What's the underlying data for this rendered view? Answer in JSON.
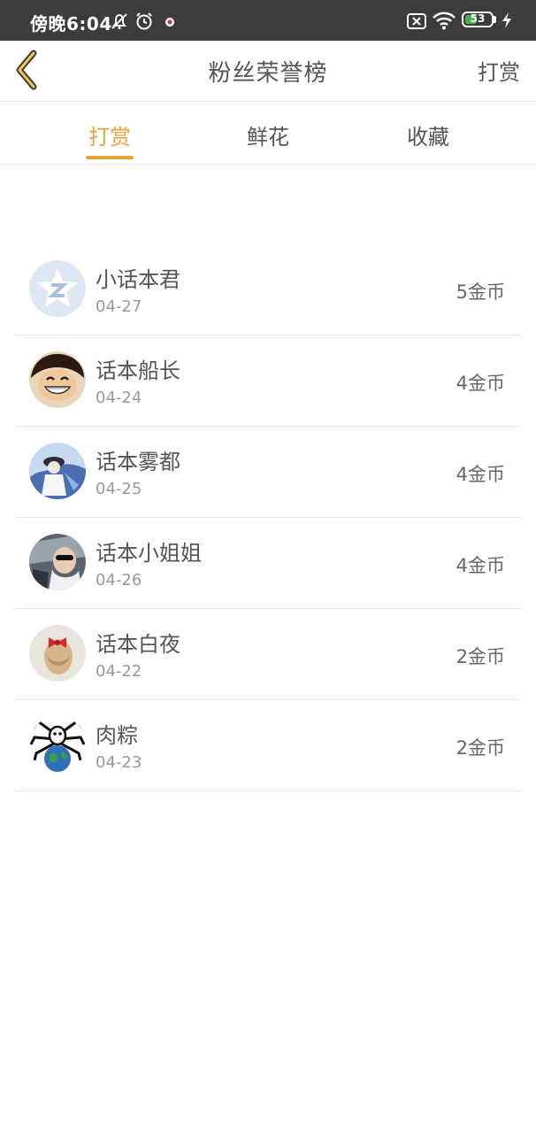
{
  "status": {
    "time": "傍晚6:04",
    "battery_level": "53",
    "battery_fraction": 0.53
  },
  "header": {
    "title": "粉丝荣誉榜",
    "action_label": "打赏"
  },
  "tabs": [
    {
      "label": "打赏",
      "active": true
    },
    {
      "label": "鲜花",
      "active": false
    },
    {
      "label": "收藏",
      "active": false
    }
  ],
  "list": [
    {
      "name": "小话本君",
      "date": "04-27",
      "amount": "5金币",
      "avatar": "qq-default-avatar"
    },
    {
      "name": "话本船长",
      "date": "04-24",
      "amount": "4金币",
      "avatar": "cartoon-face-avatar"
    },
    {
      "name": "话本雾都",
      "date": "04-25",
      "amount": "4金币",
      "avatar": "blue-figure-avatar"
    },
    {
      "name": "话本小姐姐",
      "date": "04-26",
      "amount": "4金币",
      "avatar": "car-selfie-avatar"
    },
    {
      "name": "话本白夜",
      "date": "04-22",
      "amount": "2金币",
      "avatar": "red-bow-avatar"
    },
    {
      "name": "肉粽",
      "date": "04-23",
      "amount": "2金币",
      "avatar": "globe-spider-avatar"
    }
  ],
  "colors": {
    "accent": "#e8a33a",
    "status_bar": "#3c3c3c",
    "text": "#555555",
    "muted": "#999999"
  }
}
